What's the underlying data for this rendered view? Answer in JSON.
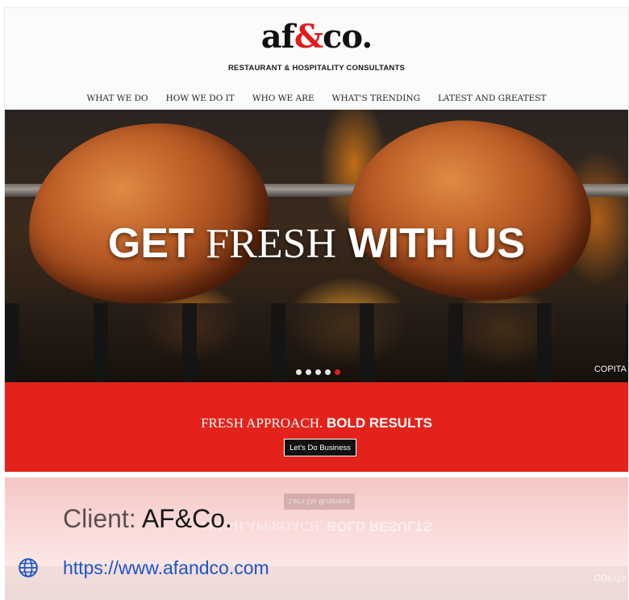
{
  "site": {
    "logo": {
      "pre": "af",
      "amp": "&",
      "post": "co."
    },
    "tagline": "RESTAURANT & HOSPITALITY CONSULTANTS",
    "nav": [
      "WHAT WE DO",
      "HOW WE DO IT",
      "WHO WE ARE",
      "WHAT'S TRENDING",
      "LATEST AND GREATEST"
    ],
    "hero": {
      "headline_part1": "GET",
      "headline_part2": "FRESH",
      "headline_part3": "WITH US",
      "caption": "COPITA",
      "slides": 5,
      "active_slide": 5
    },
    "band": {
      "title_light": "FRESH APPROACH.",
      "title_bold": "BOLD RESULTS",
      "cta_label": "Let's Do Business"
    }
  },
  "client": {
    "label": "Client:",
    "name": "AF&Co."
  },
  "link": {
    "url": "https://www.afandco.com",
    "icon": "globe-icon"
  },
  "colors": {
    "accent": "#e3231b",
    "link": "#1a56c8",
    "active_dot": "#e02020"
  }
}
